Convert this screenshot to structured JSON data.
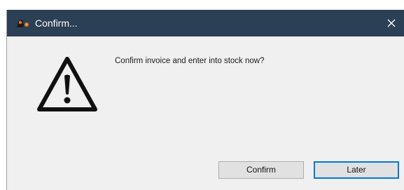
{
  "window": {
    "title": "Confirm...",
    "app_icon": "app-logo-icon",
    "close_icon": "close-icon"
  },
  "dialog": {
    "icon": "warning-icon",
    "message": "Confirm invoice and enter into stock now?"
  },
  "buttons": {
    "confirm_label": "Confirm",
    "later_label": "Later"
  },
  "colors": {
    "titlebar": "#2b3f55",
    "dialog_background": "#f0f0f0",
    "default_button_border": "#0078d7"
  }
}
